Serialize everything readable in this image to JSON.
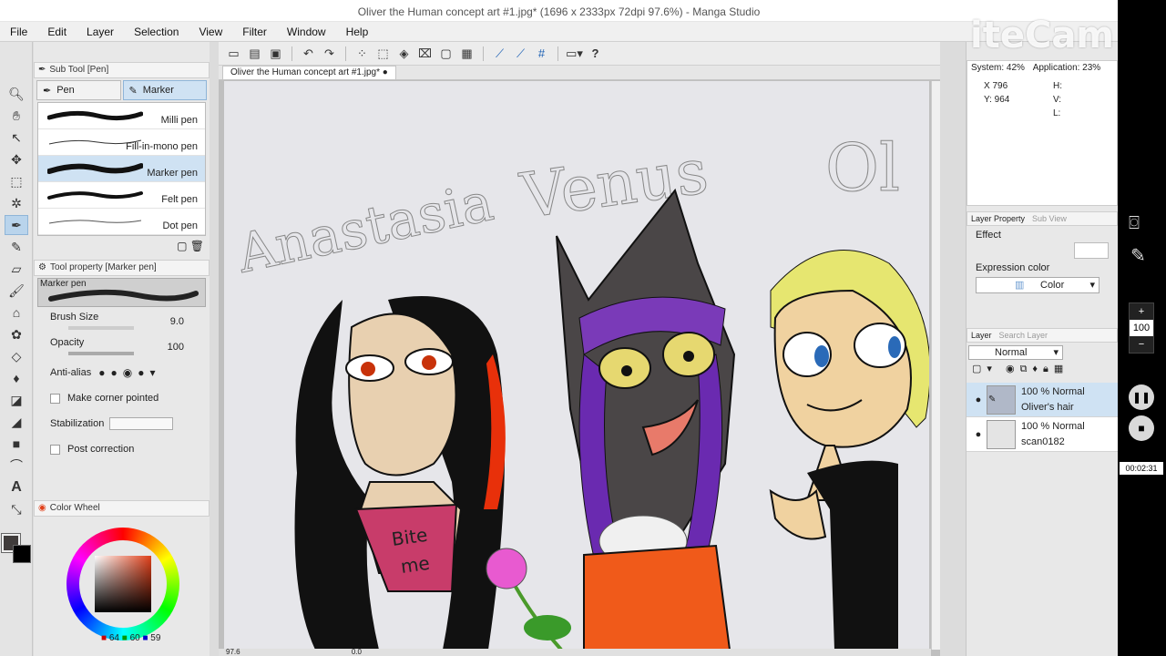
{
  "window": {
    "title": "Oliver the Human concept art #1.jpg* (1696 x 2333px 72dpi 97.6%)  - Manga Studio"
  },
  "menu": [
    "File",
    "Edit",
    "Layer",
    "Selection",
    "View",
    "Filter",
    "Window",
    "Help"
  ],
  "subtool": {
    "panel_title": "Sub Tool [Pen]",
    "tabs": [
      "Pen",
      "Marker"
    ],
    "brushes": [
      "Milli pen",
      "Fill-in-mono pen",
      "Marker pen",
      "Felt pen",
      "Dot pen"
    ]
  },
  "toolprop": {
    "panel_title": "Tool property [Marker pen]",
    "preview_label": "Marker pen",
    "brush_size_label": "Brush Size",
    "brush_size_value": "9.0",
    "opacity_label": "Opacity",
    "opacity_value": "100",
    "antialias_label": "Anti-alias",
    "corner_label": "Make corner pointed",
    "stabilization_label": "Stabilization",
    "postcorrection_label": "Post correction"
  },
  "colorwheel": {
    "title": "Color Wheel",
    "r": "64",
    "g": "60",
    "b": "59",
    "accent": "#e0401a"
  },
  "document": {
    "tab": "Oliver the Human concept art #1.jpg*",
    "zoom": "97.6",
    "angle": "0.0"
  },
  "art": {
    "name1": "Anastasia",
    "name2": "Venus",
    "name3": "Ol",
    "shirt_text1": "Bite",
    "shirt_text2": "me"
  },
  "navigator": {
    "system": "System: 42%",
    "application": "Application: 23%",
    "x": "X 796",
    "y": "Y: 964",
    "h": "H:",
    "v": "V:",
    "l": "L:"
  },
  "layerprop": {
    "title": "Layer Property",
    "tab2": "Sub View",
    "effect": "Effect",
    "expression": "Expression color",
    "color": "Color"
  },
  "layers": {
    "title": "Layer",
    "tab2": "Search Layer",
    "blend": "Normal",
    "items": [
      {
        "opacity": "100 %",
        "mode": "Normal",
        "name": "Oliver's hair"
      },
      {
        "opacity": "100 %",
        "mode": "Normal",
        "name": "scan0182"
      }
    ]
  },
  "recorder": {
    "watermark": "iteCam",
    "zoom": "100",
    "time": "00:02:31"
  }
}
